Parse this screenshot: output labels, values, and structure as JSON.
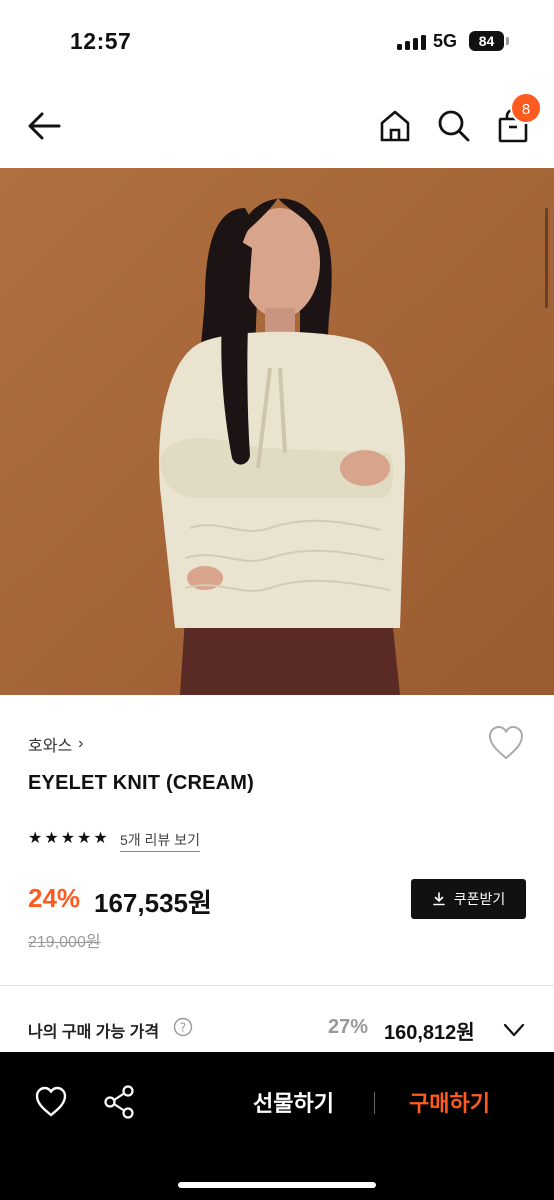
{
  "status": {
    "time": "12:57",
    "network": "5G",
    "battery": "84"
  },
  "nav": {
    "cart_count": "8"
  },
  "product": {
    "brand": "호와스",
    "brand_chevron": "›",
    "title": "EYELET KNIT (CREAM)",
    "rating_stars": 5,
    "review_link": "5개 리뷰 보기",
    "discount": "24%",
    "price": "167,535원",
    "original_price": "219,000원",
    "coupon_button": "쿠폰받기"
  },
  "my_price": {
    "label": "나의 구매 가능 가격",
    "discount": "27%",
    "price": "160,812원"
  },
  "bottom_bar": {
    "gift_label": "선물하기",
    "buy_label": "구매하기"
  },
  "colors": {
    "accent": "#ff5a1f",
    "hero_background": "#a9673a",
    "sweater": "#e9e3cf",
    "bottom_bar": "#000000"
  },
  "icons": [
    "back-arrow-icon",
    "home-icon",
    "search-icon",
    "shopping-bag-icon",
    "heart-icon",
    "share-icon",
    "question-icon",
    "chevron-down-icon",
    "download-icon"
  ]
}
